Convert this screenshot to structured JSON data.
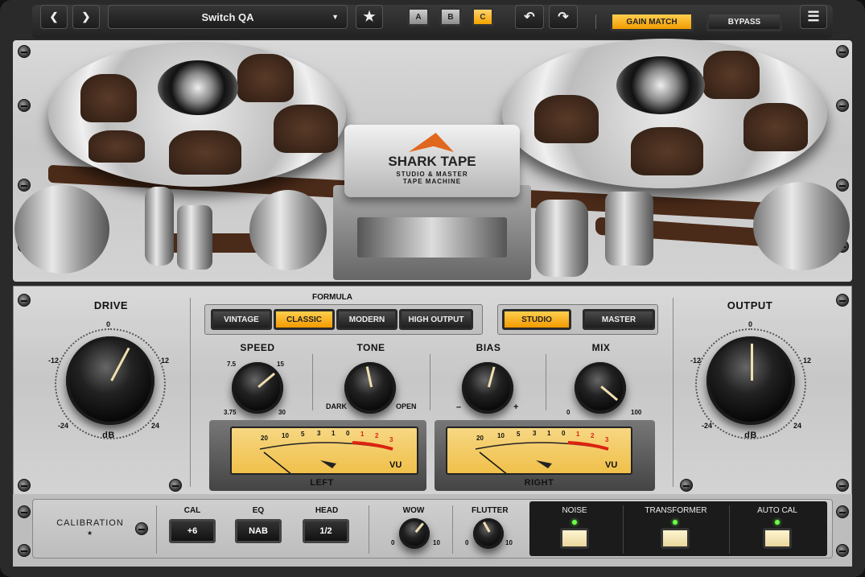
{
  "topbar": {
    "preset_name": "Switch QA",
    "ab_buttons": [
      "A",
      "B",
      "C"
    ],
    "ab_selected": "C",
    "gain_match_label": "GAIN MATCH",
    "bypass_label": "BYPASS"
  },
  "brand": {
    "name": "SHARK TAPE",
    "subtitle1": "STUDIO & MASTER",
    "subtitle2": "TAPE MACHINE"
  },
  "drive": {
    "title": "DRIVE",
    "unit": "dB",
    "ticks": {
      "top": "0",
      "left": "-12",
      "right": "12",
      "bl": "-24",
      "br": "24"
    }
  },
  "output": {
    "title": "OUTPUT",
    "unit": "dB",
    "ticks": {
      "top": "0",
      "left": "-12",
      "right": "12",
      "bl": "-24",
      "br": "24"
    }
  },
  "formula": {
    "title": "FORMULA",
    "options": [
      "VINTAGE",
      "CLASSIC",
      "MODERN",
      "HIGH OUTPUT"
    ],
    "selected": "CLASSIC"
  },
  "mode": {
    "options": [
      "STUDIO",
      "MASTER"
    ],
    "selected": "STUDIO"
  },
  "knobs": {
    "speed": {
      "title": "SPEED",
      "t1": "7.5",
      "t2": "15",
      "t3": "3.75",
      "t4": "30"
    },
    "tone": {
      "title": "TONE",
      "left": "DARK",
      "right": "OPEN"
    },
    "bias": {
      "title": "BIAS",
      "left": "–",
      "right": "+"
    },
    "mix": {
      "title": "MIX",
      "left": "0",
      "right": "100"
    }
  },
  "vu": {
    "scale": [
      "20",
      "10",
      "5",
      "3",
      "1",
      "0",
      "1",
      "2",
      "3"
    ],
    "unit": "VU",
    "left_label": "LEFT",
    "right_label": "RIGHT"
  },
  "bottom": {
    "calibration_label": "CALIBRATION",
    "cal": {
      "title": "CAL",
      "value": "+6"
    },
    "eq": {
      "title": "EQ",
      "value": "NAB"
    },
    "head": {
      "title": "HEAD",
      "value": "1/2"
    },
    "wow": {
      "title": "WOW",
      "min": "0",
      "max": "10"
    },
    "flutter": {
      "title": "FLUTTER",
      "min": "0",
      "max": "10"
    },
    "noise_label": "NOISE",
    "transformer_label": "TRANSFORMER",
    "autocal_label": "AUTO CAL"
  },
  "colors": {
    "accent": "#f5a800",
    "led": "#6dff4a",
    "tape": "#4a2a18"
  }
}
